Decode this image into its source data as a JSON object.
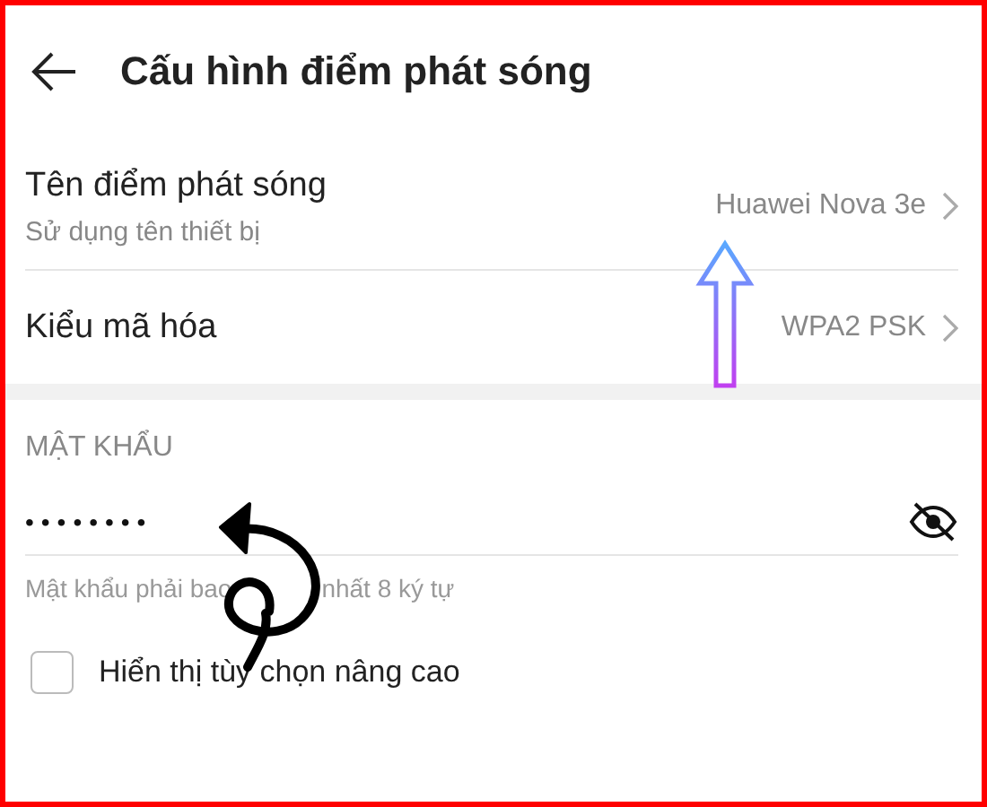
{
  "header": {
    "title": "Cấu hình điểm phát sóng"
  },
  "settings": [
    {
      "label": "Tên điểm phát sóng",
      "subtitle": "Sử dụng tên thiết bị",
      "value": "Huawei Nova 3e"
    },
    {
      "label": "Kiểu mã hóa",
      "value": "WPA2 PSK"
    }
  ],
  "password": {
    "heading": "MẬT KHẨU",
    "value": "••••••••",
    "visible": false,
    "hint": [
      "Mật khẩu phải bao",
      "nhất 8 ký tự"
    ]
  },
  "advanced": {
    "label": "Hiển thị tùy chọn nâng cao",
    "checked": false
  }
}
